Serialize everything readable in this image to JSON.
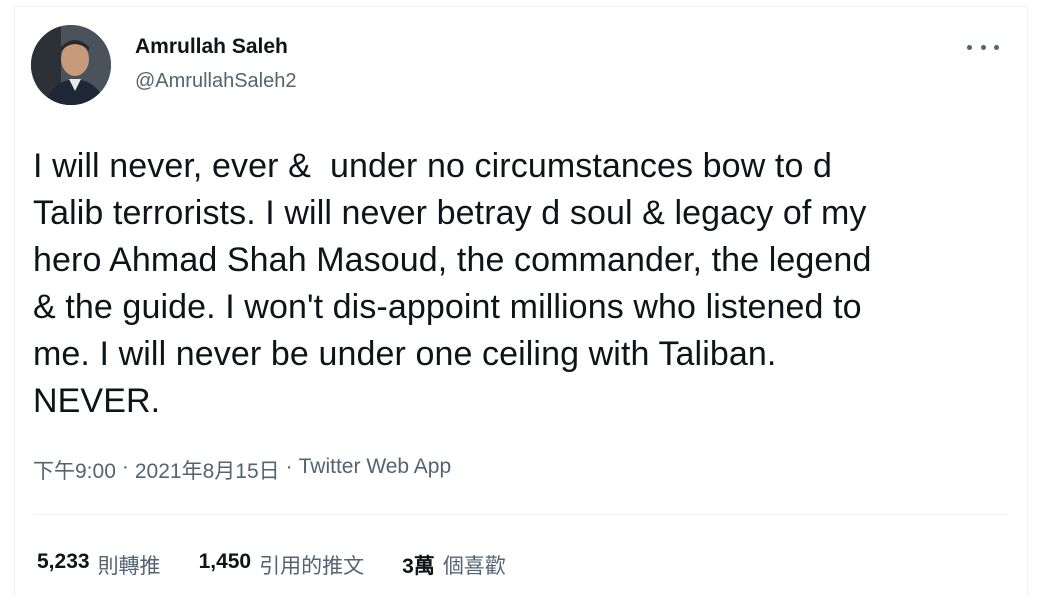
{
  "author": {
    "name": "Amrullah Saleh",
    "handle": "@AmrullahSaleh2"
  },
  "tweet": {
    "text": "I will never, ever &  under no circumstances bow to d\nTalib terrorists. I will never betray d soul & legacy of my\nhero Ahmad Shah Masoud, the commander, the legend\n& the guide. I won't dis-appoint millions who listened to\nme. I will never be under one ceiling with Taliban.\nNEVER."
  },
  "meta": {
    "time": "下午9:00",
    "separator1": "·",
    "date": "2021年8月15日",
    "separator2": "·",
    "source": "Twitter Web App"
  },
  "stats": {
    "retweets_count": "5,233",
    "retweets_label": "則轉推",
    "quotes_count": "1,450",
    "quotes_label": "引用的推文",
    "likes_count": "3萬",
    "likes_label": "個喜歡"
  },
  "icons": {
    "more": "more-horizontal-icon"
  },
  "colors": {
    "primary_text": "#0f1419",
    "secondary_text": "#536471",
    "divider": "#eff3f4"
  }
}
